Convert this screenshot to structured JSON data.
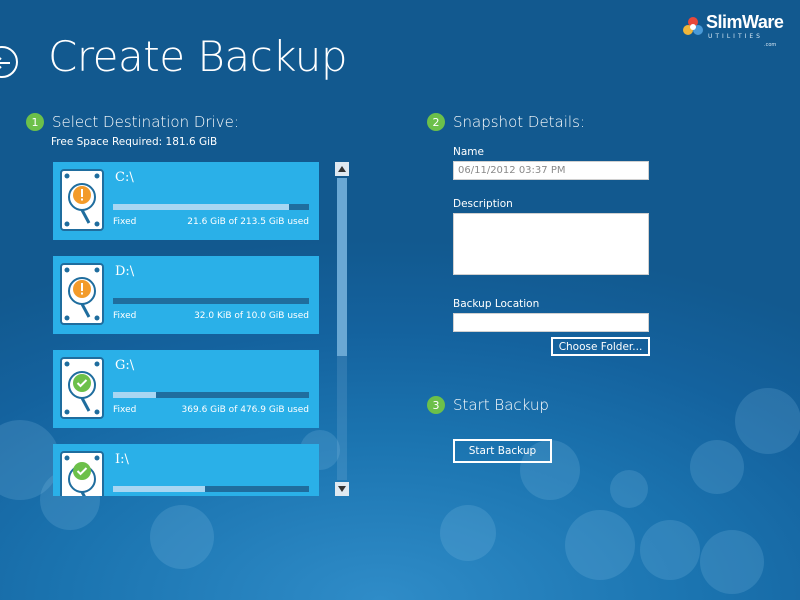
{
  "app": {
    "title": "Create Backup",
    "logo": {
      "brand": "SlimWare",
      "sub": "UTILITIES",
      "sub2": ".com"
    }
  },
  "steps": [
    {
      "number": "1",
      "label": "Select Destination Drive:"
    },
    {
      "number": "2",
      "label": "Snapshot Details:"
    },
    {
      "number": "3",
      "label": "Start Backup"
    }
  ],
  "destination": {
    "free_space": "Free Space Required: 181.6 GiB",
    "drives": [
      {
        "letter": "C:\\",
        "type": "Fixed",
        "usage": "21.6 GiB of 213.5 GiB used",
        "used_fraction": 0.9,
        "status": "warning"
      },
      {
        "letter": "D:\\",
        "type": "Fixed",
        "usage": "32.0 KiB of 10.0 GiB used",
        "used_fraction": 0.0,
        "status": "warning"
      },
      {
        "letter": "G:\\",
        "type": "Fixed",
        "usage": "369.6 GiB of 476.9 GiB used",
        "used_fraction": 0.22,
        "status": "ok"
      },
      {
        "letter": "I:\\",
        "type": "",
        "usage": "",
        "used_fraction": 0.47,
        "status": "ok"
      }
    ]
  },
  "snapshot": {
    "name_label": "Name",
    "name_value": "06/11/2012 03:37 PM",
    "description_label": "Description",
    "description_value": "",
    "location_label": "Backup Location",
    "location_value": "",
    "choose_folder_label": "Choose Folder..."
  },
  "start": {
    "button_label": "Start Backup"
  },
  "colors": {
    "background": "#1b74b0",
    "card": "#2ab0e8",
    "step_badge": "#6cc04a",
    "warning": "#f39b2a",
    "ok": "#6cc04a"
  },
  "icons": {
    "back": "back-arrow-icon",
    "warning": "warning-icon",
    "ok": "check-icon",
    "drive": "hard-drive-icon"
  }
}
